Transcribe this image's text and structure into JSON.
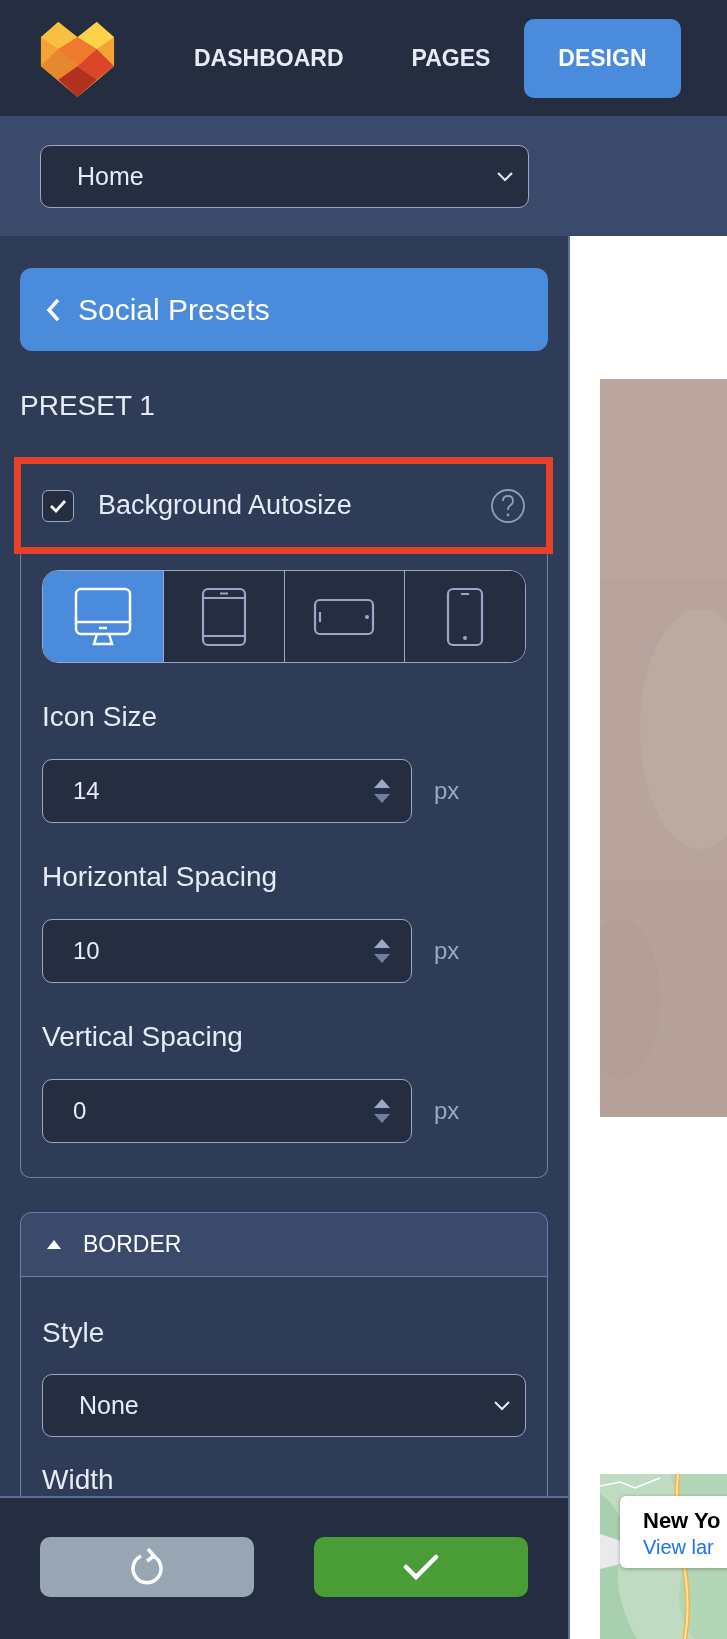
{
  "nav": {
    "items": [
      {
        "label": "DASHBOARD",
        "selected": false
      },
      {
        "label": "PAGES",
        "selected": false
      },
      {
        "label": "DESIGN",
        "selected": true
      }
    ]
  },
  "page_select": {
    "value": "Home"
  },
  "back_button": {
    "label": "Social Presets"
  },
  "section_title": "PRESET 1",
  "autosize": {
    "label": "Background Autosize",
    "checked": true,
    "highlighted": true
  },
  "devices": [
    {
      "kind": "desktop",
      "selected": true
    },
    {
      "kind": "tablet",
      "selected": false
    },
    {
      "kind": "tablet-landscape",
      "selected": false
    },
    {
      "kind": "phone",
      "selected": false
    }
  ],
  "fields": [
    {
      "label": "Icon Size",
      "value": "14",
      "unit": "px"
    },
    {
      "label": "Horizontal Spacing",
      "value": "10",
      "unit": "px"
    },
    {
      "label": "Vertical Spacing",
      "value": "0",
      "unit": "px"
    }
  ],
  "border_section": {
    "title": "BORDER",
    "expanded": true,
    "style_label": "Style",
    "style_value": "None",
    "next_label": "Width"
  },
  "preview": {
    "map_card": {
      "title": "New Yo",
      "link": "View lar"
    }
  }
}
